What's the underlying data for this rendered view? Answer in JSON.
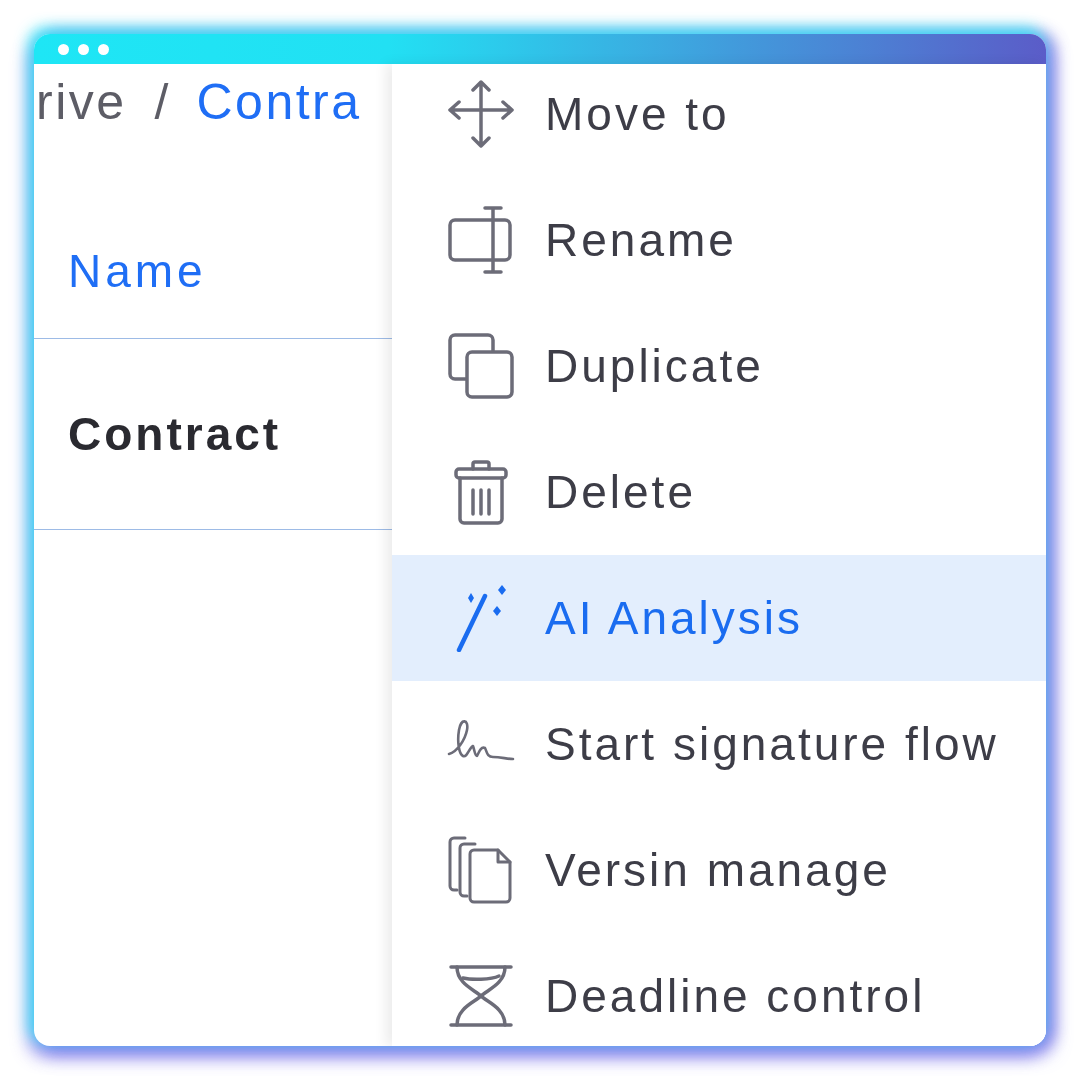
{
  "breadcrumb": {
    "separator": "/",
    "items": [
      {
        "label": "rive",
        "current": false
      },
      {
        "label": "Contra",
        "current": true
      }
    ]
  },
  "table": {
    "columns": [
      "Name"
    ],
    "rows": [
      [
        "Contract"
      ]
    ]
  },
  "context_menu": {
    "items": [
      {
        "label": "Move to",
        "selected": false
      },
      {
        "label": "Rename",
        "selected": false
      },
      {
        "label": "Duplicate",
        "selected": false
      },
      {
        "label": "Delete",
        "selected": false
      },
      {
        "label": "AI Analysis",
        "selected": true
      },
      {
        "label": "Start signature flow",
        "selected": false
      },
      {
        "label": "Versin manage",
        "selected": false
      },
      {
        "label": "Deadline control",
        "selected": false
      }
    ]
  }
}
